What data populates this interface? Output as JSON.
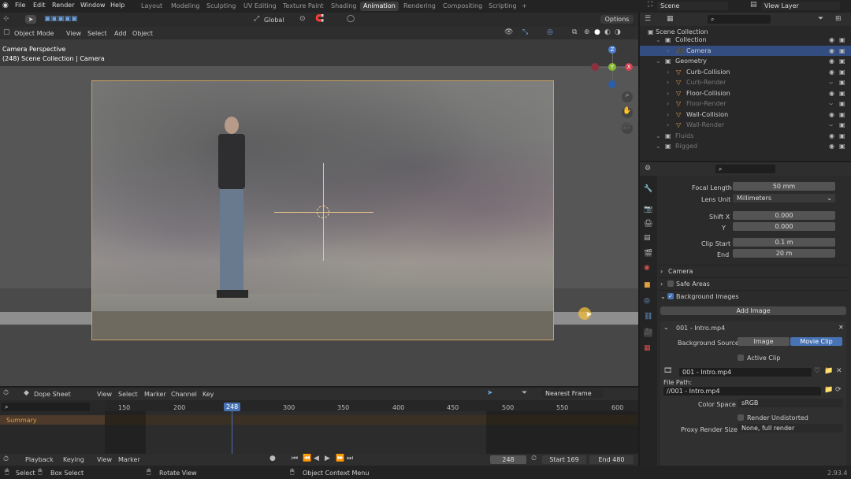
{
  "app": {
    "menus": [
      "File",
      "Edit",
      "Render",
      "Window",
      "Help"
    ]
  },
  "workspaces": [
    "Layout",
    "Modeling",
    "Sculpting",
    "UV Editing",
    "Texture Paint",
    "Shading",
    "Animation",
    "Rendering",
    "Compositing",
    "Scripting"
  ],
  "active_workspace": "Animation",
  "scene": "Scene",
  "view_layer": "View Layer",
  "viewport": {
    "mode": "Object Mode",
    "menus": [
      "View",
      "Select",
      "Add",
      "Object"
    ],
    "transform": "Global",
    "options": "Options",
    "overlay_title": "Camera Perspective",
    "overlay_sub": "(248) Scene Collection | Camera"
  },
  "outliner": {
    "root": "Scene Collection",
    "rows": [
      {
        "name": "Collection",
        "indent": 1,
        "kind": "collection"
      },
      {
        "name": "Camera",
        "indent": 2,
        "kind": "camera",
        "selected": true
      },
      {
        "name": "Geometry",
        "indent": 1,
        "kind": "collection"
      },
      {
        "name": "Curb-Collision",
        "indent": 2,
        "kind": "mesh"
      },
      {
        "name": "Curb-Render",
        "indent": 2,
        "kind": "mesh",
        "dim": true
      },
      {
        "name": "Floor-Collision",
        "indent": 2,
        "kind": "mesh"
      },
      {
        "name": "Floor-Render",
        "indent": 2,
        "kind": "mesh",
        "dim": true
      },
      {
        "name": "Wall-Collision",
        "indent": 2,
        "kind": "mesh"
      },
      {
        "name": "Wall-Render",
        "indent": 2,
        "kind": "mesh",
        "dim": true
      },
      {
        "name": "Fluids",
        "indent": 1,
        "kind": "collection",
        "dim": true
      },
      {
        "name": "Rigged",
        "indent": 1,
        "kind": "collection",
        "dim": true
      }
    ]
  },
  "props": {
    "focal_length_label": "Focal Length",
    "focal_length": "50 mm",
    "lens_unit_label": "Lens Unit",
    "lens_unit": "Millimeters",
    "shift_x_label": "Shift X",
    "shift_x": "0.000",
    "shift_y_label": "Y",
    "shift_y": "0.000",
    "clip_start_label": "Clip Start",
    "clip_start": "0.1 m",
    "clip_end_label": "End",
    "clip_end": "20 m",
    "camera_panel": "Camera",
    "safe_areas": "Safe Areas",
    "bg_images": "Background Images",
    "add_image": "Add Image",
    "clip_item": "001 - Intro.mp4",
    "bg_source_label": "Background Source",
    "bg_source_image": "Image",
    "bg_source_movie": "Movie Clip",
    "active_clip": "Active Clip",
    "clip_name": "001 - Intro.mp4",
    "file_path_label": "File Path:",
    "file_path": "//001 - Intro.mp4",
    "color_space_label": "Color Space",
    "color_space": "sRGB",
    "render_undistorted": "Render Undistorted",
    "proxy_label": "Proxy Render Size",
    "proxy_value": "None, full render"
  },
  "dopesheet": {
    "editor": "Dope Sheet",
    "menus": [
      "View",
      "Select",
      "Marker",
      "Channel",
      "Key"
    ],
    "snap": "Nearest Frame",
    "summary": "Summary",
    "frames": [
      "150",
      "200",
      "248",
      "300",
      "350",
      "400",
      "450",
      "500",
      "550",
      "600"
    ],
    "current_frame": "248"
  },
  "timeline": {
    "menus": [
      "Playback",
      "Keying",
      "View",
      "Marker"
    ],
    "frame": "248",
    "start_label": "Start",
    "start": "169",
    "end_label": "End",
    "end": "480"
  },
  "statusbar": {
    "select": "Select",
    "box_select": "Box Select",
    "rotate": "Rotate View",
    "context": "Object Context Menu",
    "version": "2.93.4"
  },
  "gizmo": {
    "z": "Z",
    "y": "Y",
    "x": "X"
  },
  "colors": {
    "accent": "#4772b3",
    "selected_row": "#334d80",
    "dark": "#1d1d1d"
  }
}
